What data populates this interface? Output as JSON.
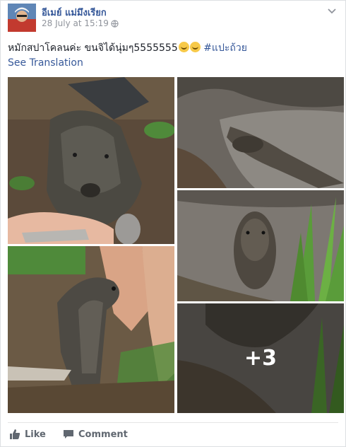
{
  "post": {
    "author": "อีเมย์ แม่มึงเรียก",
    "timestamp": "28 July at 15:19",
    "text": "หมักสปาโคลนค่ะ ขนจิได้นุ่มๆ5555555",
    "hashtag": "#แปะถ้วย",
    "see_translation": "See Translation",
    "more_photos": "+3"
  },
  "actions": {
    "like": "Like",
    "comment": "Comment"
  },
  "colors": {
    "link": "#365899",
    "meta": "#90949c",
    "action": "#606770"
  },
  "icons": [
    "globe-icon",
    "chevron-down-icon",
    "like-icon",
    "comment-icon",
    "smile-emoji"
  ]
}
